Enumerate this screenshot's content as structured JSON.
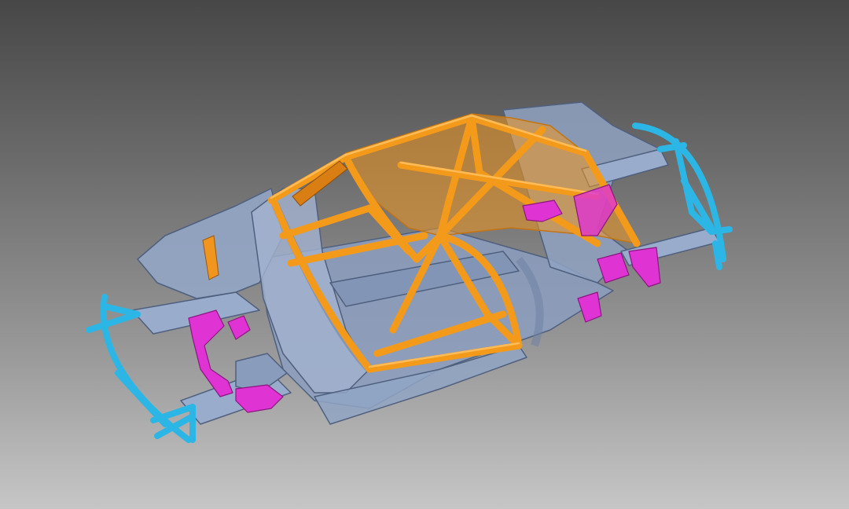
{
  "viewport": {
    "background_top": "#474747",
    "background_bottom": "#c6c6c6"
  },
  "model": {
    "parts": [
      {
        "name": "body-shell",
        "color": "#8c9fc0"
      },
      {
        "name": "roll-cage",
        "color": "#f0961e"
      },
      {
        "name": "front-crash-frame",
        "color": "#2cb6e6"
      },
      {
        "name": "rear-crash-frame",
        "color": "#2cb6e6"
      },
      {
        "name": "suspension-mounts",
        "color": "#e033d4"
      }
    ]
  }
}
